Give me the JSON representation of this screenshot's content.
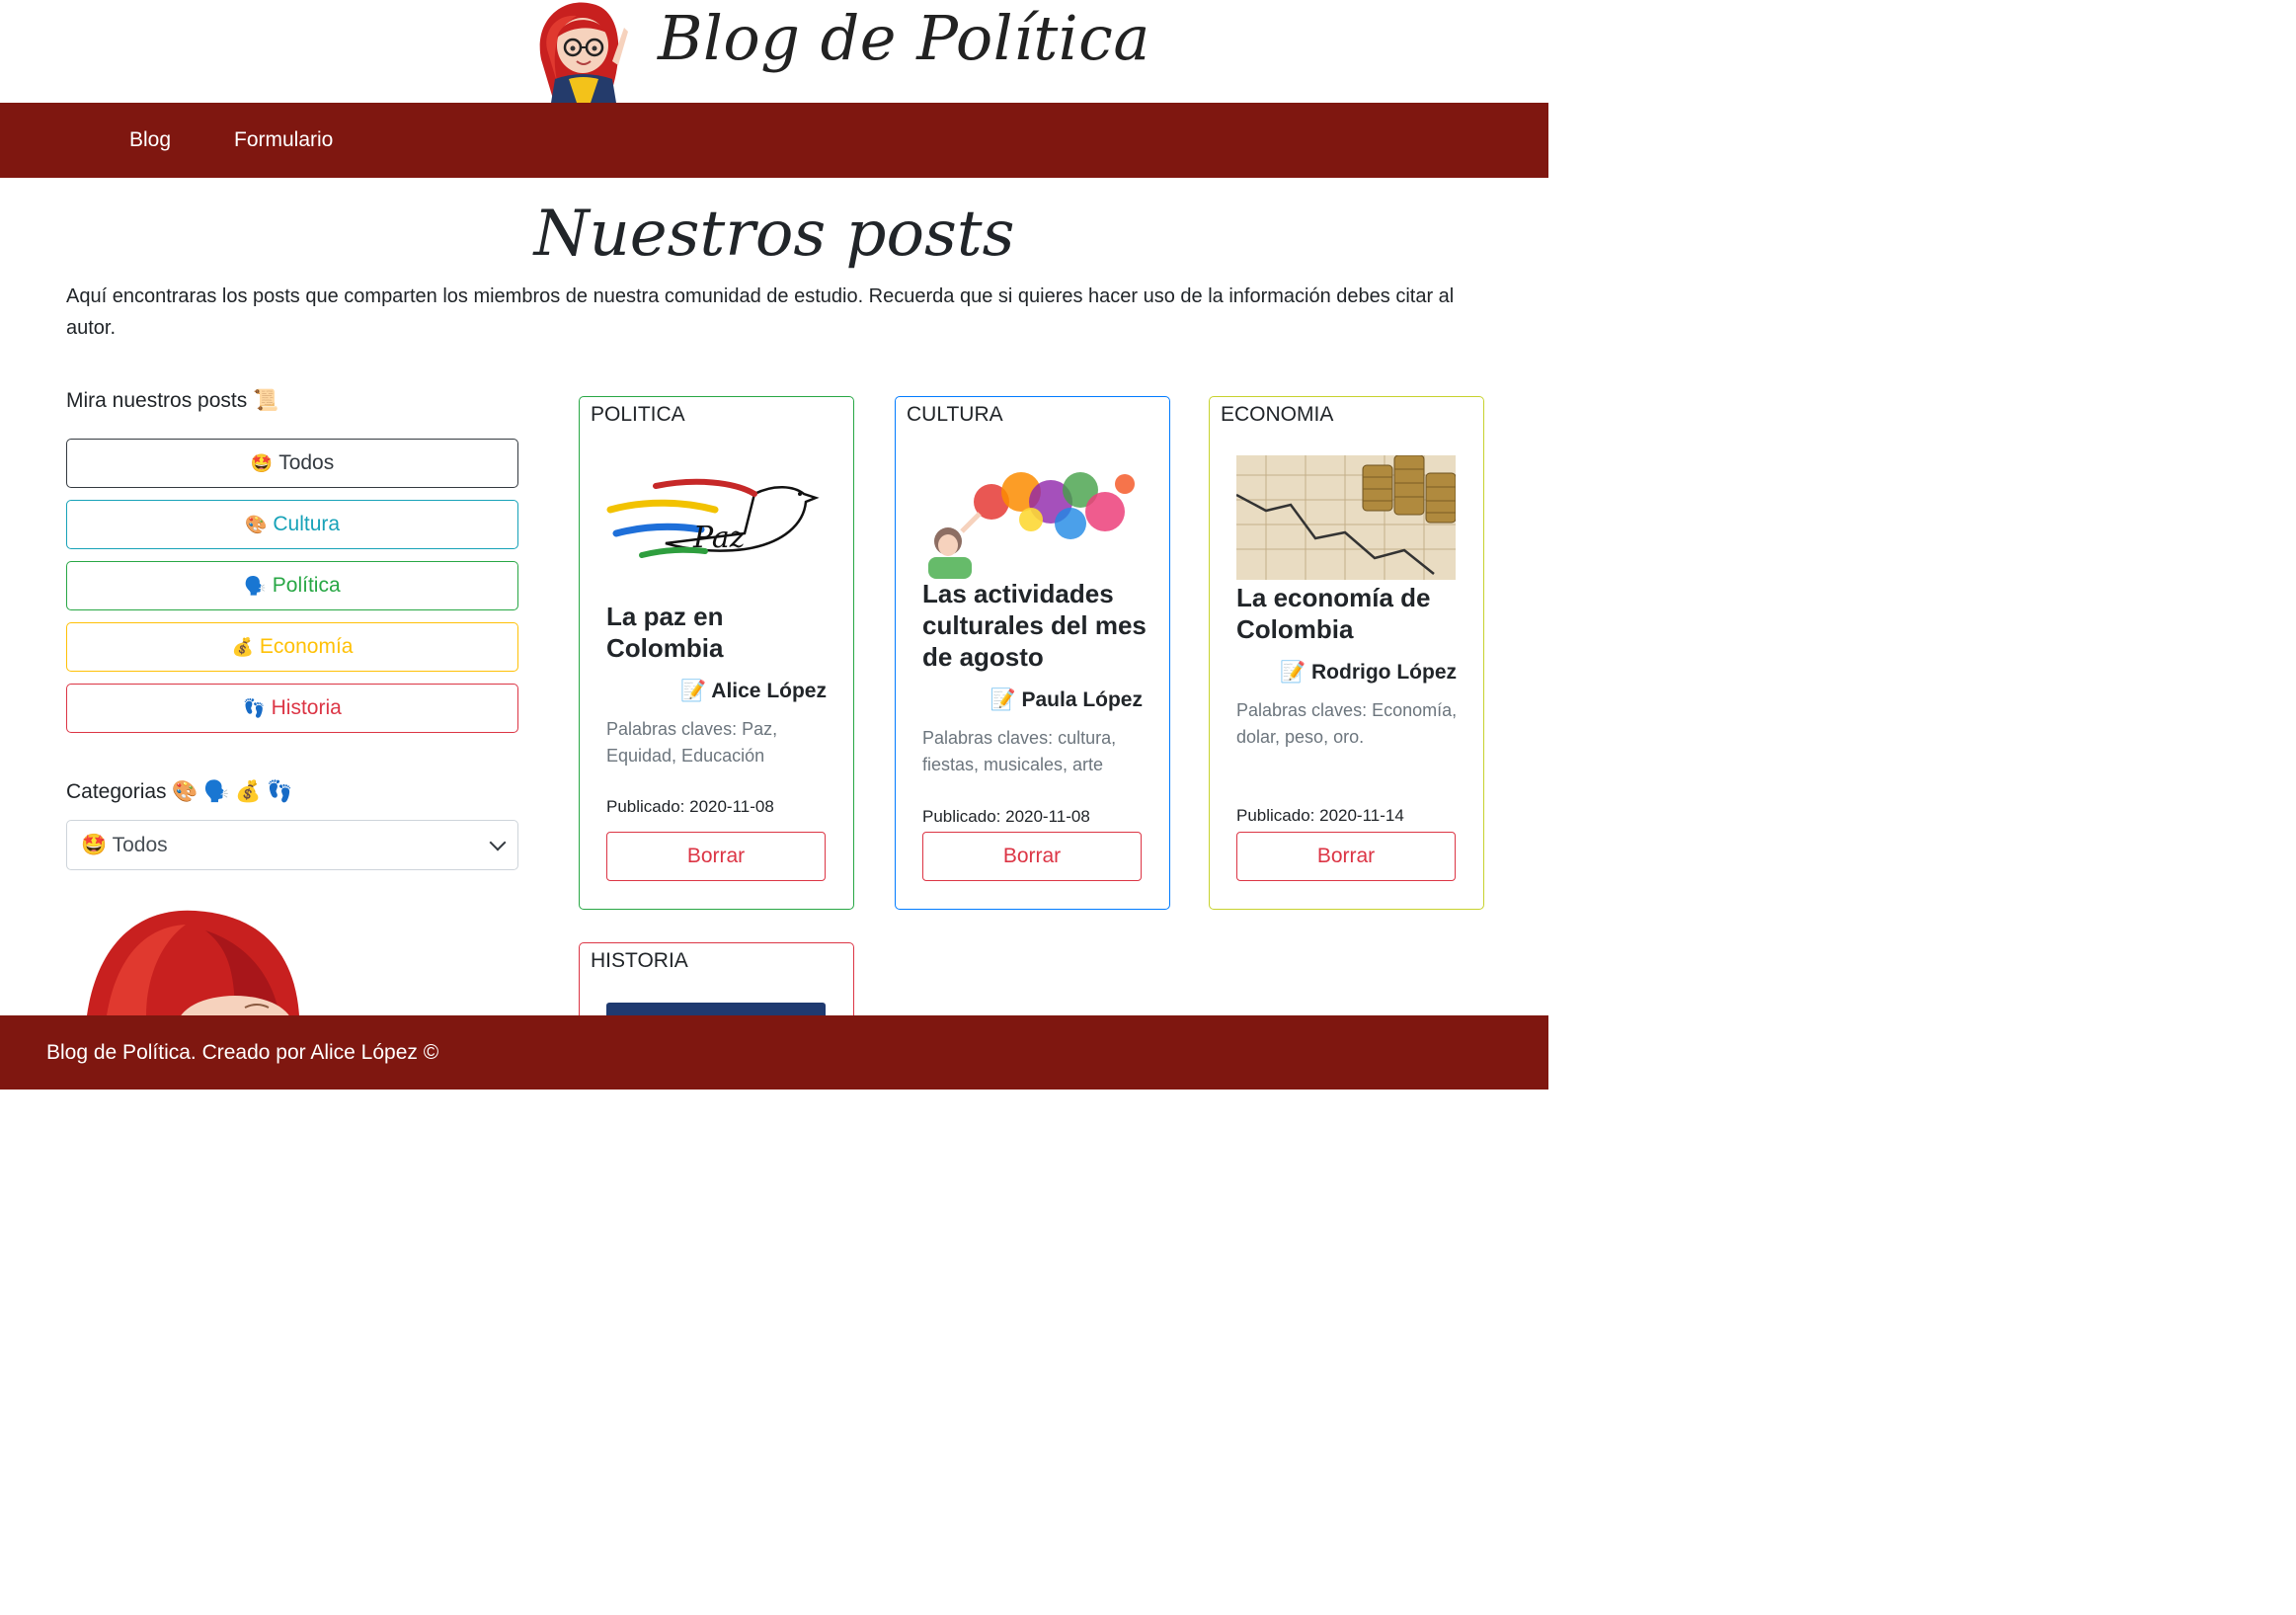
{
  "header": {
    "title": "Blog de Política"
  },
  "nav": {
    "items": [
      "Blog",
      "Formulario"
    ]
  },
  "page": {
    "heading": "Nuestros posts",
    "intro": "Aquí encontraras los posts que comparten los miembros de nuestra comunidad de estudio. Recuerda que si quieres hacer uso de la información debes citar al autor."
  },
  "filters": {
    "title": "Mira nuestros posts 📜",
    "buttons": [
      {
        "emoji": "🤩",
        "label": "Todos"
      },
      {
        "emoji": "🎨",
        "label": "Cultura"
      },
      {
        "emoji": "🗣️",
        "label": "Política"
      },
      {
        "emoji": "💰",
        "label": "Economía"
      },
      {
        "emoji": "👣",
        "label": "Historia"
      }
    ],
    "categories_label": "Categorias 🎨 🗣️ 💰 👣",
    "select_value": "🤩 Todos"
  },
  "posts": [
    {
      "category": "POLITICA",
      "title": "La paz en Colombia",
      "author": "📝 Alice López",
      "keywords": "Palabras claves: Paz, Equidad, Educación",
      "date": "Publicado: 2020-11-08",
      "delete_label": "Borrar",
      "image_text": "Paz",
      "border_color": "#28a745"
    },
    {
      "category": "CULTURA",
      "title": "Las actividades culturales del mes de agosto",
      "author": "📝 Paula López",
      "keywords": "Palabras claves: cultura, fiestas, musicales, arte",
      "date": "Publicado: 2020-11-08",
      "delete_label": "Borrar",
      "border_color": "#007bff"
    },
    {
      "category": "ECONOMIA",
      "title": "La economía de Colombia",
      "author": "📝 Rodrigo López",
      "keywords": "Palabras claves: Economía, dolar, peso, oro.",
      "date": "Publicado: 2020-11-14",
      "delete_label": "Borrar",
      "border_color": "#c7d22e"
    },
    {
      "category": "HISTORIA",
      "border_color": "#dc3545"
    }
  ],
  "footer": {
    "text": "Blog de Política. Creado por Alice López ©"
  },
  "colors": {
    "brand": "#7f1710",
    "danger": "#dc3545",
    "success": "#28a745",
    "info": "#17a2b8",
    "warning": "#ffc107"
  }
}
